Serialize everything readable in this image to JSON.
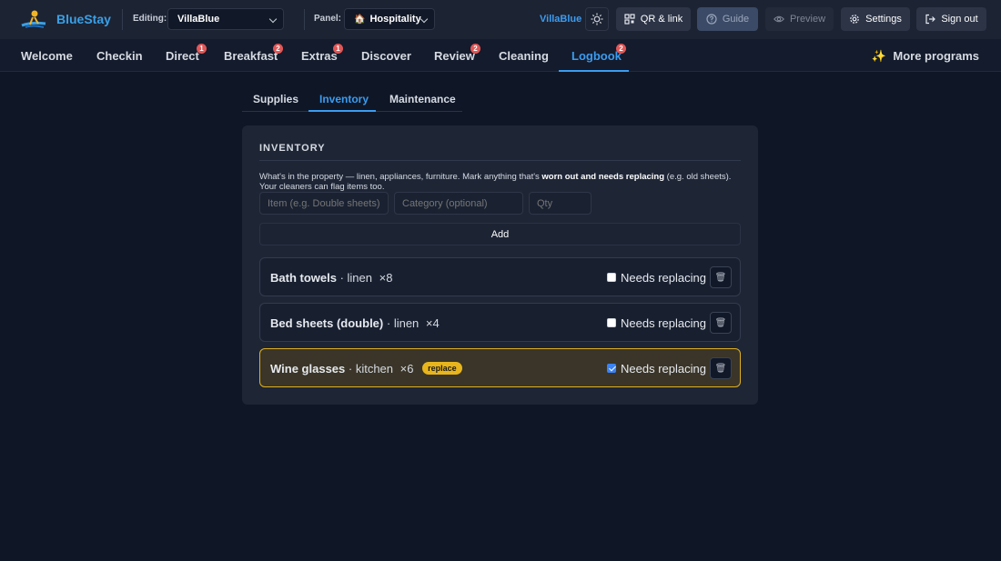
{
  "app": {
    "brand": "BlueStay"
  },
  "header": {
    "editing_label": "Editing:",
    "property_value": "VillaBlue",
    "panel_label": "Panel:",
    "panel_value": "Hospitality",
    "panel_icon": "house-icon",
    "account_name": "VillaBlue",
    "buttons": {
      "qr": "QR & link",
      "guide": "Guide",
      "preview": "Preview",
      "settings": "Settings",
      "signout": "Sign out"
    }
  },
  "nav": {
    "items": [
      {
        "label": "Welcome",
        "badge": ""
      },
      {
        "label": "Checkin",
        "badge": ""
      },
      {
        "label": "Direct",
        "badge": "1"
      },
      {
        "label": "Breakfast",
        "badge": "2"
      },
      {
        "label": "Extras",
        "badge": "1"
      },
      {
        "label": "Discover",
        "badge": ""
      },
      {
        "label": "Review",
        "badge": "2"
      },
      {
        "label": "Cleaning",
        "badge": ""
      },
      {
        "label": "Logbook",
        "badge": "2"
      }
    ],
    "active": "Logbook",
    "more": "More programs"
  },
  "subtabs": {
    "items": [
      "Supplies",
      "Inventory",
      "Maintenance"
    ],
    "active": "Inventory"
  },
  "inventory": {
    "title": "INVENTORY",
    "desc_pre": "What's in the property — linen, appliances, furniture. Mark anything that's ",
    "desc_bold": "worn out and needs replacing",
    "desc_post": " (e.g. old sheets). Your cleaners can flag items too.",
    "placeholders": {
      "item": "Item (e.g. Double sheets)",
      "category": "Category (optional)",
      "qty": "Qty"
    },
    "add_label": "Add",
    "checkbox_label": "Needs replacing",
    "trash_icon": "🗑",
    "items": [
      {
        "name": "Bath towels",
        "category": "· linen",
        "qty": "×8",
        "needs_replacing": false,
        "tag": ""
      },
      {
        "name": "Bed sheets (double)",
        "category": "· linen",
        "qty": "×4",
        "needs_replacing": false,
        "tag": ""
      },
      {
        "name": "Wine glasses",
        "category": "· kitchen",
        "qty": "×6",
        "needs_replacing": true,
        "tag": "replace"
      }
    ]
  },
  "colors": {
    "accent": "#3b9cf0",
    "badge": "#e25656",
    "warn": "#e8b51c",
    "bg": "#0f1727",
    "card": "#1e2636"
  }
}
